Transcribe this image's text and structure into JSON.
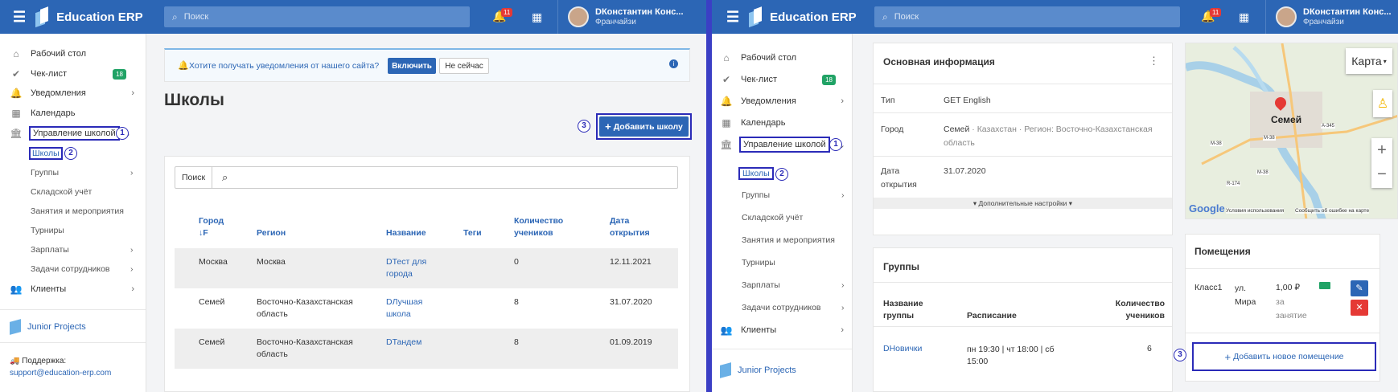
{
  "app": {
    "title": "Education ERP",
    "search_placeholder": "Поиск",
    "notifications_count": "11",
    "user_name": "DКонстантин Конс...",
    "user_role": "Франчайзи"
  },
  "sidebar": {
    "items": [
      {
        "label": "Рабочий стол",
        "icon": "home-icon"
      },
      {
        "label": "Чек-лист",
        "icon": "check-icon",
        "badge": "18"
      },
      {
        "label": "Уведомления",
        "icon": "bell-icon"
      },
      {
        "label": "Календарь",
        "icon": "calendar-icon"
      },
      {
        "label": "Управление школой",
        "icon": "school-icon"
      },
      {
        "label": "Клиенты",
        "icon": "users-icon"
      }
    ],
    "sub_items": [
      "Школы",
      "Группы",
      "Складской учёт",
      "Занятия и мероприятия",
      "Турниры",
      "Зарплаты",
      "Задачи сотрудников"
    ],
    "junior_projects": "Junior Projects",
    "support_label": "Поддержка:",
    "support_email": "support@education-erp.com"
  },
  "steps": [
    "1",
    "2",
    "3"
  ],
  "left": {
    "notice_text": "Хотите получать уведомления от нашего сайта?",
    "notice_enable": "Включить",
    "notice_later": "Не сейчас",
    "page_title": "Школы",
    "add_button": "Добавить школу",
    "search_label": "Поиск",
    "table": {
      "headers": [
        "Город",
        "Регион",
        "Название",
        "Теги",
        "Количество учеников",
        "Дата открытия"
      ],
      "sort_marker": "↓F",
      "rows": [
        {
          "city": "Москва",
          "region": "Москва",
          "name": "DТест для города",
          "tags": "",
          "students": "0",
          "date": "12.11.2021"
        },
        {
          "city": "Семей",
          "region": "Восточно-Казахстанская область",
          "name": "DЛучшая школа",
          "tags": "",
          "students": "8",
          "date": "31.07.2020"
        },
        {
          "city": "Семей",
          "region": "Восточно-Казахстанская область",
          "name": "DТандем",
          "tags": "",
          "students": "8",
          "date": "01.09.2019"
        }
      ]
    }
  },
  "right": {
    "info_title": "Основная информация",
    "fields": [
      {
        "label": "Тип",
        "value": "GET English"
      },
      {
        "label": "Город",
        "value_main": "Семей",
        "value_extra": "· Казахстан · Регион: Восточно-Казахстанская область"
      },
      {
        "label": "Дата открытия",
        "value": "31.07.2020"
      }
    ],
    "more_settings": "▾ Дополнительные настройки ▾",
    "groups_title": "Группы",
    "groups_headers": [
      "Название группы",
      "Расписание",
      "Количество учеников"
    ],
    "group_row": {
      "name": "DНовички",
      "schedule": "пн 19:30 | чт 18:00 | сб 15:00",
      "students": "6"
    },
    "map": {
      "type_button": "Карта",
      "city": "Семей",
      "road_labels": [
        "M-38",
        "M-38",
        "M-38",
        "A-345",
        "R-174"
      ],
      "google": "Google",
      "terms": "Условия использования",
      "report": "Сообщить об ошибке на карте",
      "zoom_in": "+",
      "zoom_out": "−"
    },
    "rooms_title": "Помещения",
    "room": {
      "name": "Класс1",
      "address": "ул. Мира",
      "price": "1,00 ₽",
      "per": "за занятие"
    },
    "add_room": "Добавить новое помещение"
  }
}
